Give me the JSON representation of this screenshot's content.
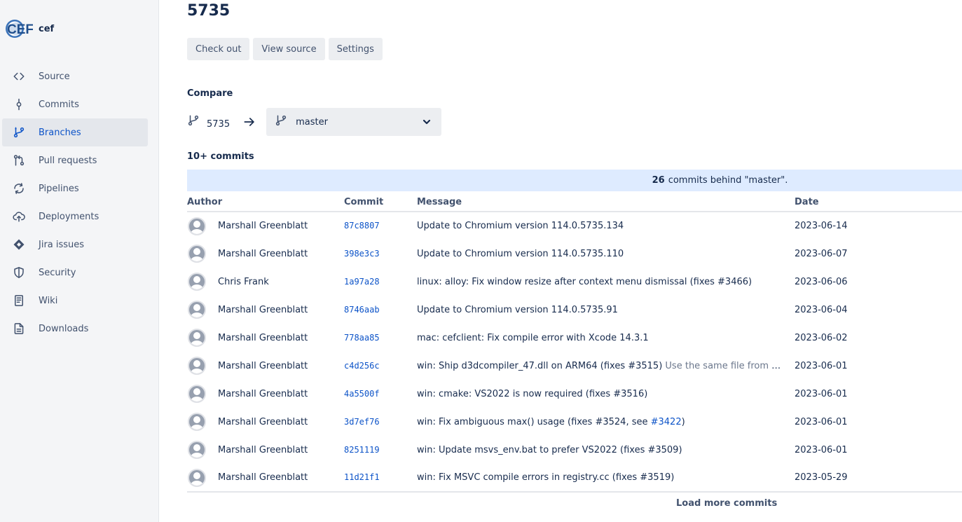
{
  "repo": {
    "name": "cef",
    "logo_text": "CEF"
  },
  "sidebar": {
    "items": [
      {
        "label": "Source",
        "icon": "code-icon",
        "active": false
      },
      {
        "label": "Commits",
        "icon": "commit-icon",
        "active": false
      },
      {
        "label": "Branches",
        "icon": "branch-icon",
        "active": true
      },
      {
        "label": "Pull requests",
        "icon": "pull-request-icon",
        "active": false
      },
      {
        "label": "Pipelines",
        "icon": "pipelines-icon",
        "active": false
      },
      {
        "label": "Deployments",
        "icon": "deployments-icon",
        "active": false
      },
      {
        "label": "Jira issues",
        "icon": "jira-icon",
        "active": false
      },
      {
        "label": "Security",
        "icon": "shield-icon",
        "active": false
      },
      {
        "label": "Wiki",
        "icon": "wiki-icon",
        "active": false
      },
      {
        "label": "Downloads",
        "icon": "downloads-icon",
        "active": false
      }
    ]
  },
  "page": {
    "title": "5735",
    "actions": {
      "checkout": "Check out",
      "view_source": "View source",
      "settings": "Settings"
    },
    "compare": {
      "label": "Compare",
      "source_branch": "5735",
      "target_branch": "master"
    },
    "commits_count": "10+ commits",
    "behind": {
      "count": "26",
      "text": "commits behind \"master\"."
    },
    "table": {
      "headers": {
        "author": "Author",
        "commit": "Commit",
        "message": "Message",
        "date": "Date"
      },
      "rows": [
        {
          "author": "Marshall Greenblatt",
          "hash": "87c8807",
          "message": "Update to Chromium version 114.0.5735.134",
          "date": "2023-06-14"
        },
        {
          "author": "Marshall Greenblatt",
          "hash": "398e3c3",
          "message": "Update to Chromium version 114.0.5735.110",
          "date": "2023-06-07"
        },
        {
          "author": "Chris Frank",
          "hash": "1a97a28",
          "message": "linux: alloy: Fix window resize after context menu dismissal (fixes #3466)",
          "date": "2023-06-06"
        },
        {
          "author": "Marshall Greenblatt",
          "hash": "8746aab",
          "message": "Update to Chromium version 114.0.5735.91",
          "date": "2023-06-04"
        },
        {
          "author": "Marshall Greenblatt",
          "hash": "778aa85",
          "message": "mac: cefclient: Fix compile error with Xcode 14.3.1",
          "date": "2023-06-02"
        },
        {
          "author": "Marshall Greenblatt",
          "hash": "c4d256c",
          "message": "win: Ship d3dcompiler_47.dll on ARM64 (fixes #3515)",
          "message_extra": "Use the same file from the W…",
          "date": "2023-06-01"
        },
        {
          "author": "Marshall Greenblatt",
          "hash": "4a5500f",
          "message": "win: cmake: VS2022 is now required (fixes #3516)",
          "date": "2023-06-01"
        },
        {
          "author": "Marshall Greenblatt",
          "hash": "3d7ef76",
          "message": "win: Fix ambiguous max() usage (fixes #3524, see ",
          "message_link": "#3422",
          "message_suffix": ")",
          "date": "2023-06-01"
        },
        {
          "author": "Marshall Greenblatt",
          "hash": "8251119",
          "message": "win: Update msvs_env.bat to prefer VS2022 (fixes #3509)",
          "date": "2023-06-01"
        },
        {
          "author": "Marshall Greenblatt",
          "hash": "11d21f1",
          "message": "win: Fix MSVC compile errors in registry.cc (fixes #3519)",
          "date": "2023-05-29"
        }
      ]
    },
    "load_more": "Load more commits"
  },
  "colors": {
    "accent": "#0c53c8",
    "sidebar_bg": "#f4f5f7",
    "banner_bg": "#deebff"
  }
}
